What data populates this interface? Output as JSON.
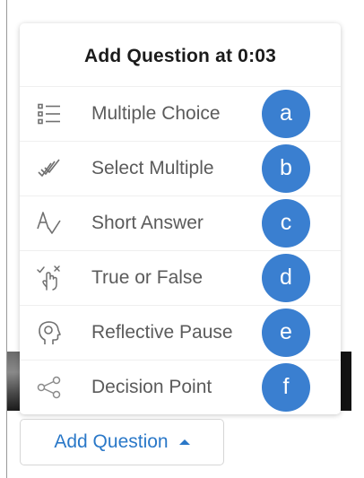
{
  "menu": {
    "title": "Add Question at 0:03",
    "items": [
      {
        "label": "Multiple Choice",
        "icon": "list-icon",
        "badge": "a"
      },
      {
        "label": "Select Multiple",
        "icon": "checkmarks-icon",
        "badge": "b"
      },
      {
        "label": "Short Answer",
        "icon": "text-check-icon",
        "badge": "c"
      },
      {
        "label": "True or False",
        "icon": "hand-check-x-icon",
        "badge": "d"
      },
      {
        "label": "Reflective Pause",
        "icon": "head-profile-icon",
        "badge": "e"
      },
      {
        "label": "Decision Point",
        "icon": "branch-share-icon",
        "badge": "f"
      }
    ]
  },
  "add_button": {
    "label": "Add Question"
  },
  "colors": {
    "accent": "#2a78c8",
    "badge": "#3a7fd0",
    "label_text": "#5b5b5b",
    "title_text": "#1b1b1b",
    "icon_stroke": "#707070"
  }
}
